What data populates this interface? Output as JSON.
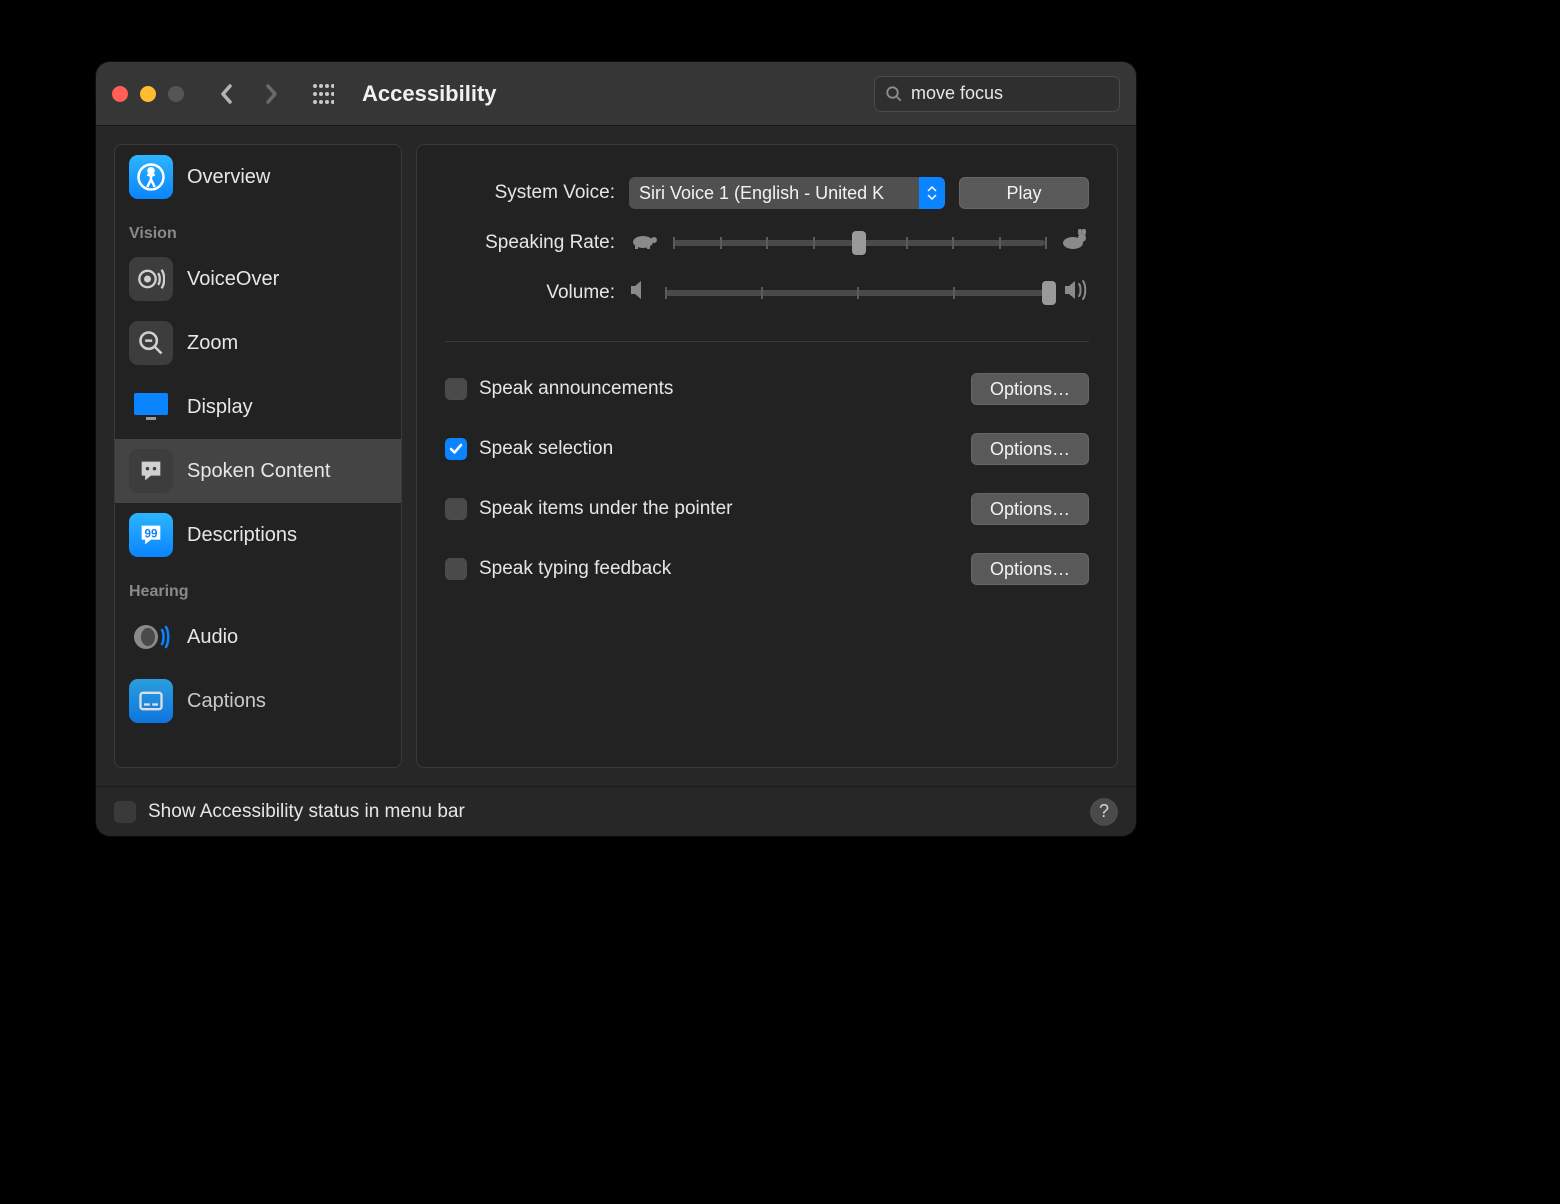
{
  "titlebar": {
    "title": "Accessibility",
    "search_value": "move focus"
  },
  "sidebar": {
    "overview": "Overview",
    "section_vision": "Vision",
    "voiceover": "VoiceOver",
    "zoom": "Zoom",
    "display": "Display",
    "spoken_content": "Spoken Content",
    "descriptions": "Descriptions",
    "section_hearing": "Hearing",
    "audio": "Audio",
    "captions": "Captions"
  },
  "main": {
    "system_voice_label": "System Voice:",
    "system_voice_value": "Siri Voice 1 (English - United K",
    "play_button": "Play",
    "speaking_rate_label": "Speaking Rate:",
    "speaking_rate_pct": 50,
    "volume_label": "Volume:",
    "volume_pct": 100,
    "speak_announcements": "Speak announcements",
    "speak_selection": "Speak selection",
    "speak_pointer": "Speak items under the pointer",
    "speak_typing": "Speak typing feedback",
    "options_button": "Options…"
  },
  "footer": {
    "status_label": "Show Accessibility status in menu bar"
  }
}
